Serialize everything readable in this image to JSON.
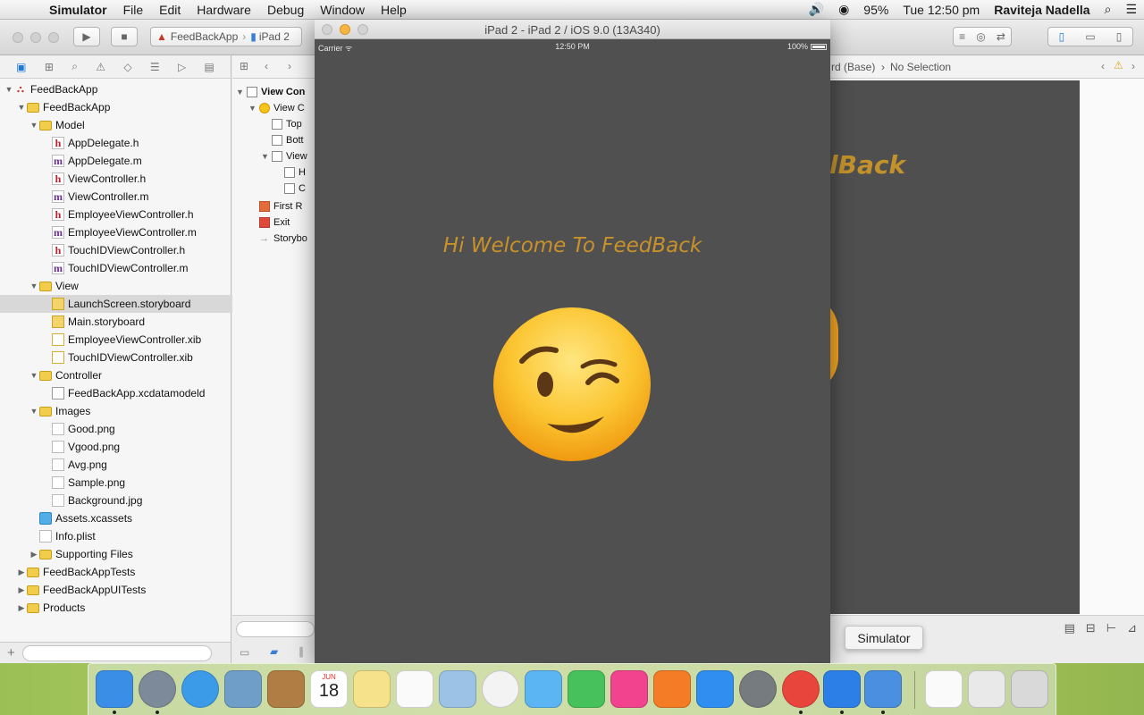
{
  "menubar": {
    "app": "Simulator",
    "items": [
      "File",
      "Edit",
      "Hardware",
      "Debug",
      "Window",
      "Help"
    ],
    "battery": "95%",
    "clock": "Tue 12:50 pm",
    "user": "Raviteja Nadella"
  },
  "toolbar": {
    "scheme": "FeedBackApp",
    "device": "iPad 2"
  },
  "navigator": {
    "items": [
      {
        "label": "FeedBackApp",
        "indent": 0,
        "icon": "proj",
        "disc": "open"
      },
      {
        "label": "FeedBackApp",
        "indent": 1,
        "icon": "folder",
        "disc": "open"
      },
      {
        "label": "Model",
        "indent": 2,
        "icon": "folder",
        "disc": "open"
      },
      {
        "label": "AppDelegate.h",
        "indent": 3,
        "icon": "h"
      },
      {
        "label": "AppDelegate.m",
        "indent": 3,
        "icon": "m"
      },
      {
        "label": "ViewController.h",
        "indent": 3,
        "icon": "h"
      },
      {
        "label": "ViewController.m",
        "indent": 3,
        "icon": "m"
      },
      {
        "label": "EmployeeViewController.h",
        "indent": 3,
        "icon": "h"
      },
      {
        "label": "EmployeeViewController.m",
        "indent": 3,
        "icon": "m"
      },
      {
        "label": "TouchIDViewController.h",
        "indent": 3,
        "icon": "h"
      },
      {
        "label": "TouchIDViewController.m",
        "indent": 3,
        "icon": "m"
      },
      {
        "label": "View",
        "indent": 2,
        "icon": "folder",
        "disc": "open"
      },
      {
        "label": "LaunchScreen.storyboard",
        "indent": 3,
        "icon": "sb",
        "selected": true
      },
      {
        "label": "Main.storyboard",
        "indent": 3,
        "icon": "sb"
      },
      {
        "label": "EmployeeViewController.xib",
        "indent": 3,
        "icon": "xib"
      },
      {
        "label": "TouchIDViewController.xib",
        "indent": 3,
        "icon": "xib"
      },
      {
        "label": "Controller",
        "indent": 2,
        "icon": "folder",
        "disc": "open"
      },
      {
        "label": "FeedBackApp.xcdatamodeld",
        "indent": 3,
        "icon": "data"
      },
      {
        "label": "Images",
        "indent": 2,
        "icon": "folder",
        "disc": "open"
      },
      {
        "label": "Good.png",
        "indent": 3,
        "icon": "img"
      },
      {
        "label": "Vgood.png",
        "indent": 3,
        "icon": "img"
      },
      {
        "label": "Avg.png",
        "indent": 3,
        "icon": "img"
      },
      {
        "label": "Sample.png",
        "indent": 3,
        "icon": "img"
      },
      {
        "label": "Background.jpg",
        "indent": 3,
        "icon": "img"
      },
      {
        "label": "Assets.xcassets",
        "indent": 2,
        "icon": "assets"
      },
      {
        "label": "Info.plist",
        "indent": 2,
        "icon": "plist"
      },
      {
        "label": "Supporting Files",
        "indent": 2,
        "icon": "folder",
        "disc": "closed"
      },
      {
        "label": "FeedBackAppTests",
        "indent": 1,
        "icon": "folder",
        "disc": "closed"
      },
      {
        "label": "FeedBackAppUITests",
        "indent": 1,
        "icon": "folder",
        "disc": "closed"
      },
      {
        "label": "Products",
        "indent": 1,
        "icon": "folder",
        "disc": "closed"
      }
    ]
  },
  "outline": {
    "items": [
      {
        "label": "View Con",
        "indent": 0,
        "disc": "open",
        "bold": true
      },
      {
        "label": "View C",
        "indent": 1,
        "disc": "open",
        "icon": "yellow-circle"
      },
      {
        "label": "Top",
        "indent": 2
      },
      {
        "label": "Bott",
        "indent": 2
      },
      {
        "label": "View",
        "indent": 2,
        "disc": "open"
      },
      {
        "label": "H",
        "indent": 3
      },
      {
        "label": "C",
        "indent": 3
      },
      {
        "label": "First R",
        "indent": 1,
        "icon": "cube"
      },
      {
        "label": "Exit",
        "indent": 1,
        "icon": "exit"
      },
      {
        "label": "Storybo",
        "indent": 1,
        "icon": "arrow"
      }
    ]
  },
  "jumpbar": {
    "crumb_partial": "rd (Base)",
    "selection": "No Selection"
  },
  "canvas": {
    "ghost_text": "lBack"
  },
  "simulator": {
    "title": "iPad 2 - iPad 2 / iOS 9.0 (13A340)",
    "carrier": "Carrier",
    "time": "12:50 PM",
    "battery": "100%",
    "welcome": "Hi Welcome To FeedBack"
  },
  "tooltip": {
    "label": "Simulator"
  },
  "dock": {
    "apps": [
      {
        "name": "finder-icon",
        "color": "#3a8ee6"
      },
      {
        "name": "launchpad-icon",
        "color": "#7d8a99"
      },
      {
        "name": "safari-icon",
        "color": "#3c9be8"
      },
      {
        "name": "preview-icon",
        "color": "#6f9fc9"
      },
      {
        "name": "contacts-icon",
        "color": "#b07d45"
      },
      {
        "name": "calendar-icon",
        "color": "#ffffff",
        "text": "18",
        "subtext": "JUN"
      },
      {
        "name": "notes-icon",
        "color": "#f5e28a"
      },
      {
        "name": "reminders-icon",
        "color": "#fafafa"
      },
      {
        "name": "photo-booth-icon",
        "color": "#9cc3e6"
      },
      {
        "name": "photos-icon",
        "color": "#f3f3f3"
      },
      {
        "name": "messages-icon",
        "color": "#5bb5f3"
      },
      {
        "name": "facetime-icon",
        "color": "#47c15b"
      },
      {
        "name": "itunes-icon",
        "color": "#f2438f"
      },
      {
        "name": "ibooks-icon",
        "color": "#f57c26"
      },
      {
        "name": "app-store-icon",
        "color": "#2f8ef0"
      },
      {
        "name": "system-preferences-icon",
        "color": "#767b80"
      },
      {
        "name": "chrome-icon",
        "color": "#e8453c"
      },
      {
        "name": "xcode-icon",
        "color": "#2c7fe6"
      },
      {
        "name": "simulator-icon",
        "color": "#4a8fe0"
      },
      {
        "name": "document-icon",
        "color": "#fafafa"
      },
      {
        "name": "downloads-icon",
        "color": "#e9e9e9"
      },
      {
        "name": "trash-icon",
        "color": "#d9d9d9"
      }
    ]
  }
}
